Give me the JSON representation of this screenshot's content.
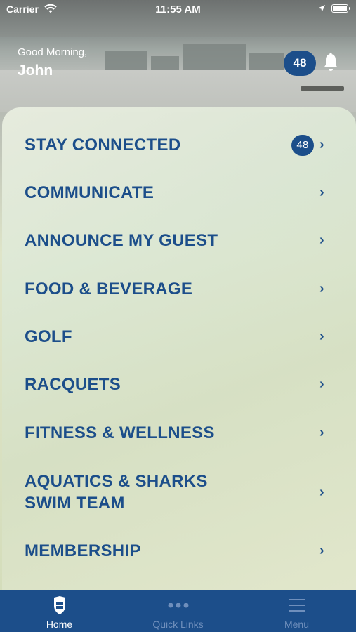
{
  "status_bar": {
    "carrier": "Carrier",
    "time": "11:55 AM"
  },
  "header": {
    "greeting": "Good Morning,",
    "name": "John",
    "notification_count": "48"
  },
  "menu": {
    "items": [
      {
        "label": "STAY CONNECTED",
        "count": "48"
      },
      {
        "label": "COMMUNICATE"
      },
      {
        "label": "ANNOUNCE MY GUEST"
      },
      {
        "label": "FOOD & BEVERAGE"
      },
      {
        "label": "GOLF"
      },
      {
        "label": "RACQUETS"
      },
      {
        "label": "FITNESS & WELLNESS"
      },
      {
        "label": "AQUATICS & SHARKS\nSWIM TEAM"
      },
      {
        "label": "MEMBERSHIP"
      }
    ]
  },
  "tabbar": {
    "tabs": [
      {
        "label": "Home",
        "icon": "club-crest-icon",
        "active": true
      },
      {
        "label": "Quick Links",
        "icon": "more-dots-icon",
        "active": false
      },
      {
        "label": "Menu",
        "icon": "hamburger-icon",
        "active": false
      }
    ]
  },
  "colors": {
    "brand_blue": "#1c4e8a"
  }
}
